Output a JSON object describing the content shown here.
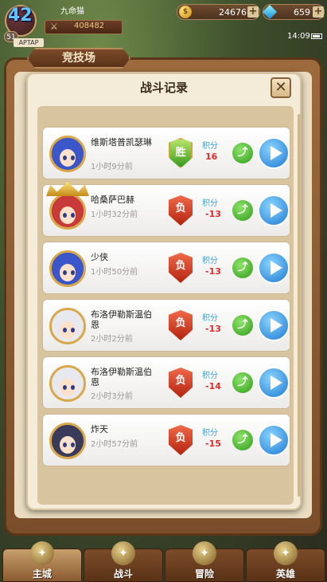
{
  "hud": {
    "level": "42",
    "sub_level": "51",
    "tap_tag": "APTAP",
    "player_name": "九命猫",
    "power": "408482",
    "gold": "24676",
    "gems": "659",
    "plus": "+",
    "time": "14:09"
  },
  "section_tag": "竞技场",
  "dialog": {
    "title": "战斗记录",
    "close": "✕"
  },
  "records": [
    {
      "name": "维斯塔普凯瑟琳",
      "time": "1小时9分前",
      "result": "胜",
      "score_label": "积分",
      "score": "16",
      "avatar_color": "#3a56c8",
      "crown": false
    },
    {
      "name": "哈桑萨巴赫",
      "time": "1小时32分前",
      "result": "负",
      "score_label": "积分",
      "score": "-13",
      "avatar_color": "#c83a3a",
      "crown": true
    },
    {
      "name": "少侠",
      "time": "1小时50分前",
      "result": "负",
      "score_label": "积分",
      "score": "-13",
      "avatar_color": "#3a56c8",
      "crown": false
    },
    {
      "name": "布洛伊勒斯温伯恩",
      "time": "2小时2分前",
      "result": "负",
      "score_label": "积分",
      "score": "-13",
      "avatar_color": "#e8e8ef",
      "crown": false
    },
    {
      "name": "布洛伊勒斯温伯恩",
      "time": "2小时3分前",
      "result": "负",
      "score_label": "积分",
      "score": "-14",
      "avatar_color": "#e8e8ef",
      "crown": false
    },
    {
      "name": "炸天",
      "time": "2小时57分前",
      "result": "负",
      "score_label": "积分",
      "score": "-15",
      "avatar_color": "#3a3a5a",
      "crown": false
    }
  ],
  "nav": [
    {
      "label": "主城",
      "icon": "castle-icon"
    },
    {
      "label": "战斗",
      "icon": "swords-icon"
    },
    {
      "label": "冒险",
      "icon": "adventurer-icon"
    },
    {
      "label": "英雄",
      "icon": "hero-helmet-icon"
    }
  ]
}
